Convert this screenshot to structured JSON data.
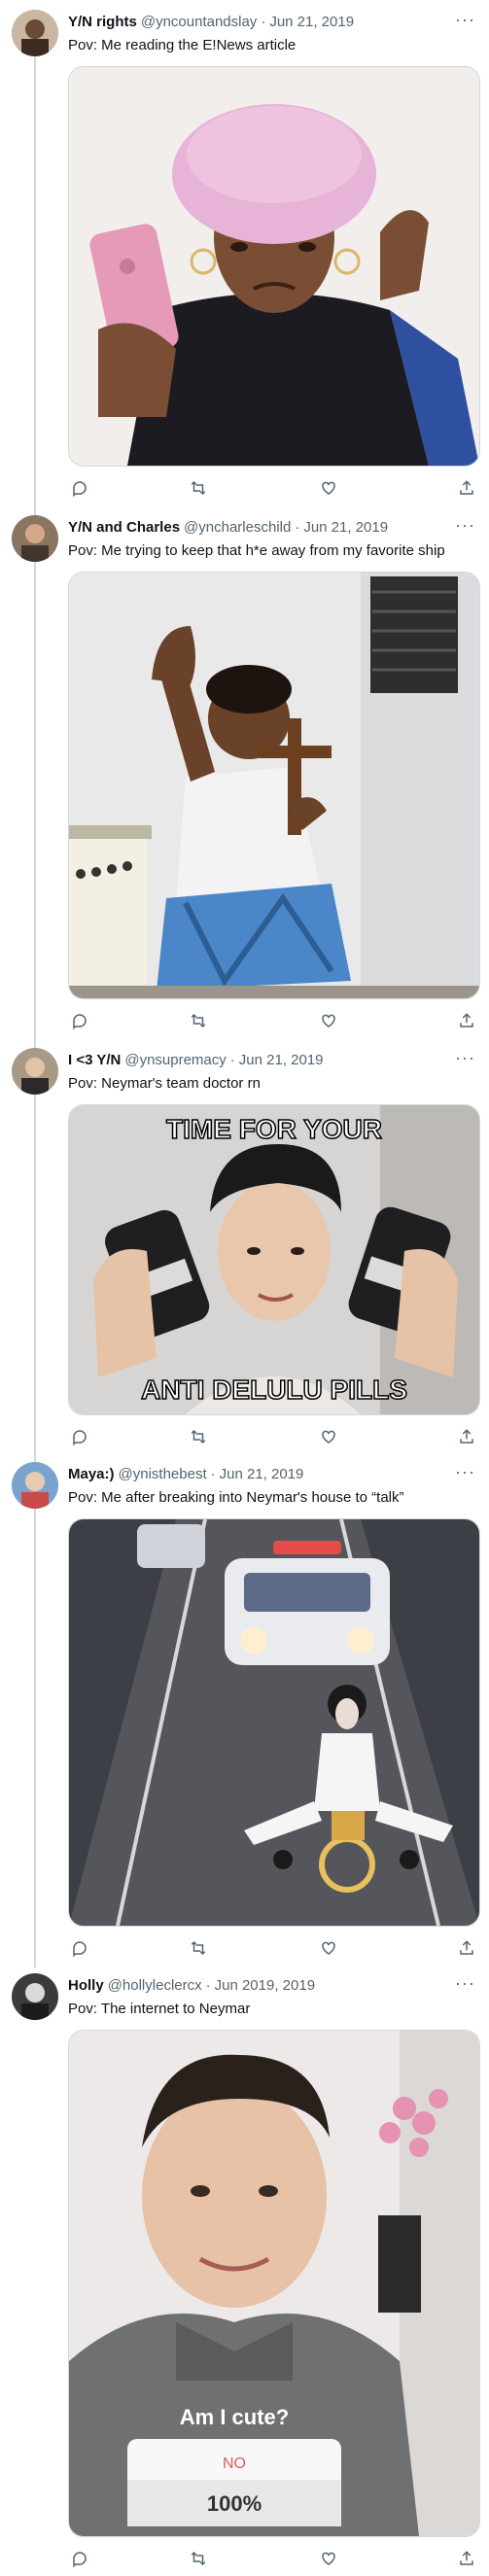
{
  "tweets": [
    {
      "name": "Y/N rights",
      "handle": "@yncountandslay",
      "date": "Jun 21, 2019",
      "text": "Pov: Me reading the E!News article",
      "more": "···"
    },
    {
      "name": "Y/N and Charles",
      "handle": "@yncharleschild",
      "date": "Jun 21, 2019",
      "text": "Pov: Me trying to keep that h*e away from my favorite ship",
      "more": "···"
    },
    {
      "name": "I <3 Y/N",
      "handle": "@ynsupremacy",
      "date": "Jun 21, 2019",
      "text": "Pov: Neymar's team doctor rn",
      "more": "···",
      "meme_top": "TIME FOR YOUR",
      "meme_bottom": "ANTI DELULU PILLS"
    },
    {
      "name": "Maya:)",
      "handle": "@ynisthebest",
      "date": "Jun 21, 2019",
      "text": "Pov: Me after breaking into Neymar's house to “talk”",
      "more": "···"
    },
    {
      "name": "Holly",
      "handle": "@hollyleclercx",
      "date": "Jun 2019, 2019",
      "text": "Pov: The internet to Neymar",
      "more": "···",
      "poll_question": "Am I cute?",
      "poll_no": "NO",
      "poll_percent": "100%"
    }
  ],
  "icons": [
    "reply-icon",
    "retweet-icon",
    "like-icon",
    "share-icon"
  ]
}
